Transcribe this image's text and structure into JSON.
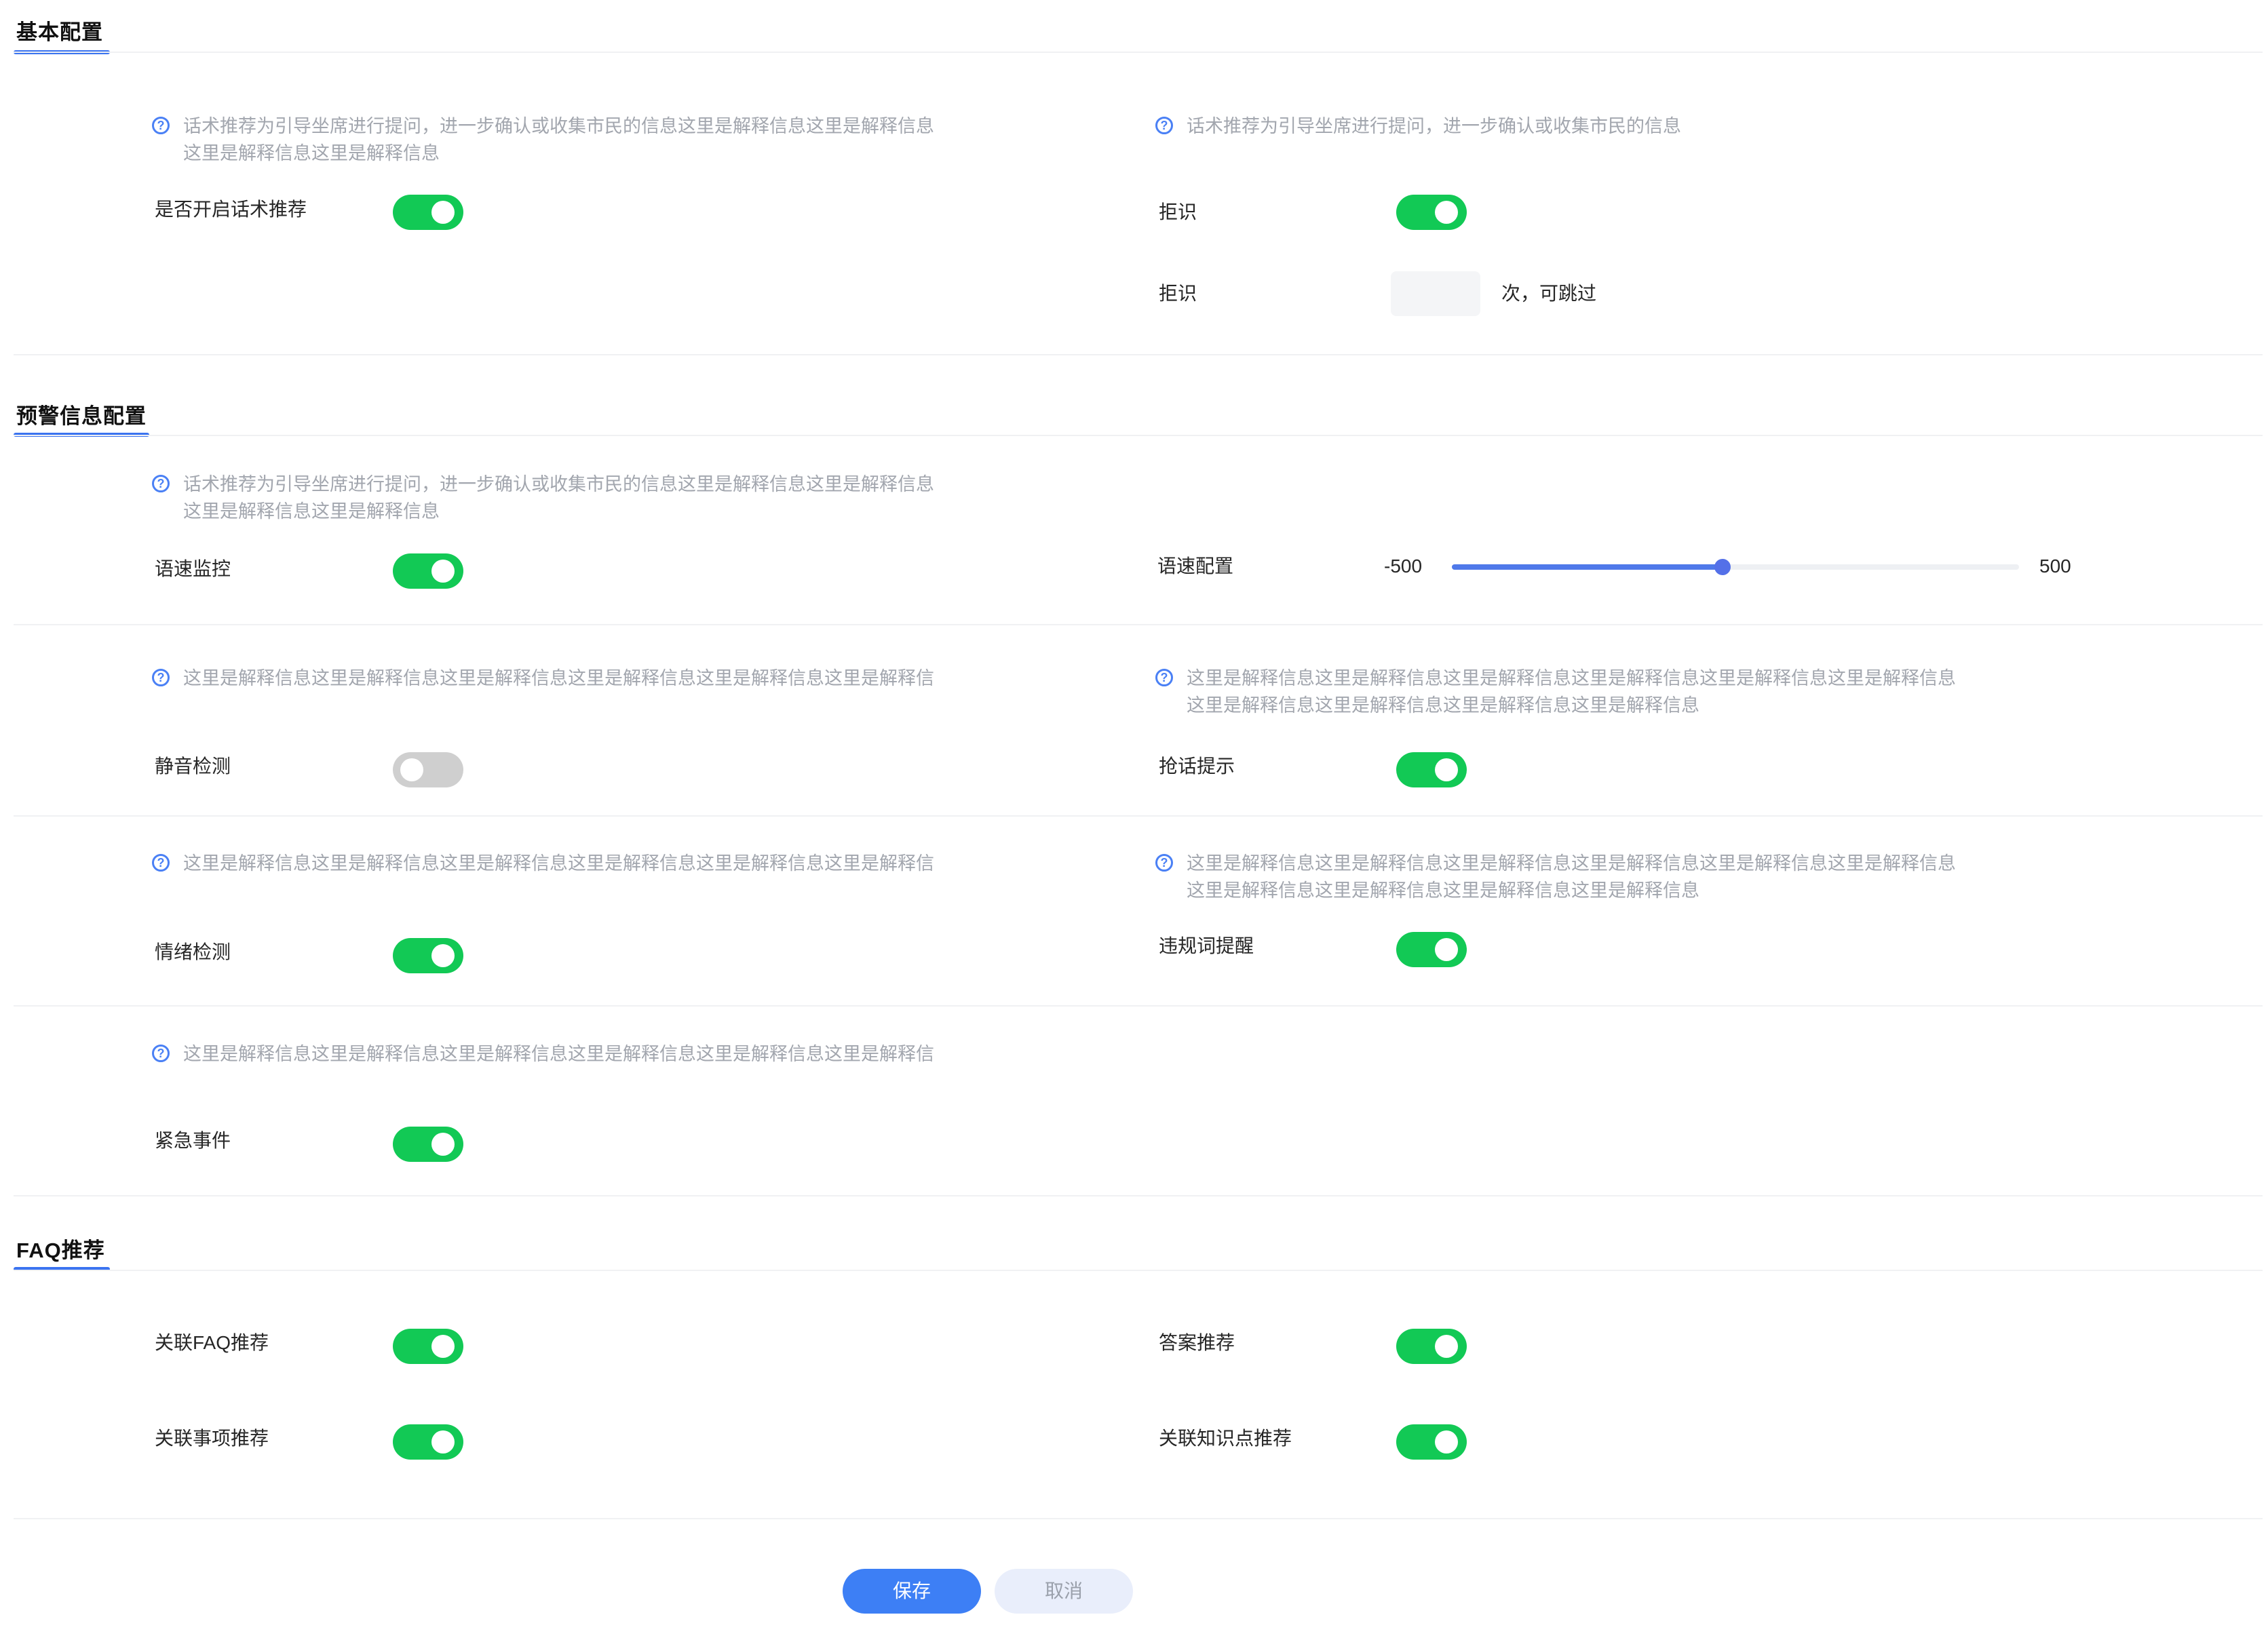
{
  "sections": {
    "basic": {
      "title": "基本配置"
    },
    "warning": {
      "title": "预警信息配置"
    },
    "faq": {
      "title": "FAQ推荐"
    }
  },
  "icons": {
    "help": "question-circle-icon",
    "help_glyph": "?"
  },
  "colors": {
    "toggle_on": "#12c955",
    "toggle_off": "#cfcfcf",
    "accent": "#3b74f0"
  },
  "basic": {
    "hint_left": [
      "话术推荐为引导坐席进行提问，进一步确认或收集市民的信息这里是解释信息这里是解释信息",
      "这里是解释信息这里是解释信息"
    ],
    "hint_right": "话术推荐为引导坐席进行提问，进一步确认或收集市民的信息",
    "script_recommend": {
      "label": "是否开启话术推荐",
      "on": true
    },
    "refuse_toggle": {
      "label": "拒识",
      "on": true
    },
    "refuse_count": {
      "label": "拒识",
      "value": "",
      "suffix": "次，可跳过"
    }
  },
  "warning": {
    "hint_speed": [
      "话术推荐为引导坐席进行提问，进一步确认或收集市民的信息这里是解释信息这里是解释信息",
      "这里是解释信息这里是解释信息"
    ],
    "speed_monitor": {
      "label": "语速监控",
      "on": true
    },
    "speed_config": {
      "label": "语速配置",
      "min": "-500",
      "max": "500",
      "value_fraction": 0.477
    },
    "hint_silence": "这里是解释信息这里是解释信息这里是解释信息这里是解释信息这里是解释信息这里是解释信",
    "silence": {
      "label": "静音检测",
      "on": false
    },
    "hint_interrupt": [
      "这里是解释信息这里是解释信息这里是解释信息这里是解释信息这里是解释信息这里是解释信息",
      "这里是解释信息这里是解释信息这里是解释信息这里是解释信息"
    ],
    "interrupt": {
      "label": "抢话提示",
      "on": true
    },
    "hint_emotion": "这里是解释信息这里是解释信息这里是解释信息这里是解释信息这里是解释信息这里是解释信",
    "emotion": {
      "label": "情绪检测",
      "on": true
    },
    "hint_violation": [
      "这里是解释信息这里是解释信息这里是解释信息这里是解释信息这里是解释信息这里是解释信息",
      "这里是解释信息这里是解释信息这里是解释信息这里是解释信息"
    ],
    "violation": {
      "label": "违规词提醒",
      "on": true
    },
    "hint_emergency": "这里是解释信息这里是解释信息这里是解释信息这里是解释信息这里是解释信息这里是解释信",
    "emergency": {
      "label": "紧急事件",
      "on": true
    }
  },
  "faq": {
    "related_faq": {
      "label": "关联FAQ推荐",
      "on": true
    },
    "answer": {
      "label": "答案推荐",
      "on": true
    },
    "related_matter": {
      "label": "关联事项推荐",
      "on": true
    },
    "related_knowledge": {
      "label": "关联知识点推荐",
      "on": true
    }
  },
  "actions": {
    "save": "保存",
    "cancel": "取消"
  }
}
